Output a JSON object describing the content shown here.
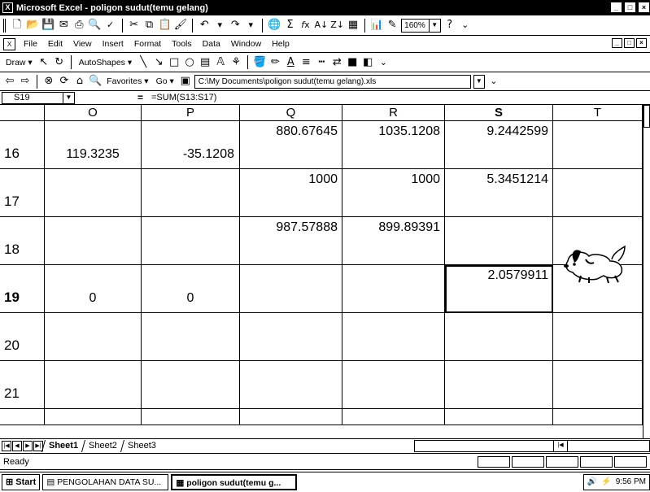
{
  "window": {
    "title": "Microsoft Excel - poligon sudut(temu gelang)",
    "buttons": [
      "_",
      "□",
      "×"
    ]
  },
  "standard_toolbar": {
    "zoom": "160%",
    "help_icon": "help-icon"
  },
  "menu": {
    "items": [
      "File",
      "Edit",
      "View",
      "Insert",
      "Format",
      "Tools",
      "Data",
      "Window",
      "Help"
    ]
  },
  "drawing_toolbar": {
    "draw_label": "Draw",
    "autoshapes_label": "AutoShapes"
  },
  "web_toolbar": {
    "favorites_label": "Favorites",
    "go_label": "Go",
    "address": "C:\\My Documents\\poligon sudut(temu gelang).xls"
  },
  "formula_bar": {
    "name_box": "S19",
    "equals": "=",
    "formula": "=SUM(S13:S17)"
  },
  "columns": [
    "O",
    "P",
    "Q",
    "R",
    "S",
    "T"
  ],
  "selected_column": "S",
  "rows": [
    {
      "num": "16",
      "cells": {
        "O": "119.3235",
        "P": "-35.1208",
        "Q": "880.67645",
        "R": "1035.1208",
        "S": "9.2442599",
        "T": ""
      }
    },
    {
      "num": "17",
      "cells": {
        "O": "",
        "P": "",
        "Q": "1000",
        "R": "1000",
        "S": "5.3451214",
        "T": ""
      }
    },
    {
      "num": "18",
      "cells": {
        "O": "",
        "P": "",
        "Q": "987.57888",
        "R": "899.89391",
        "S": "",
        "T": ""
      }
    },
    {
      "num": "19",
      "cells": {
        "O": "0",
        "P": "0",
        "Q": "",
        "R": "",
        "S": "2.0579911",
        "T": ""
      }
    },
    {
      "num": "20",
      "cells": {
        "O": "",
        "P": "",
        "Q": "",
        "R": "",
        "S": "",
        "T": ""
      }
    },
    {
      "num": "21",
      "cells": {
        "O": "",
        "P": "",
        "Q": "",
        "R": "",
        "S": "",
        "T": ""
      }
    }
  ],
  "selected_row": "19",
  "sheets": [
    "Sheet1",
    "Sheet2",
    "Sheet3"
  ],
  "active_sheet": "Sheet1",
  "status": "Ready",
  "taskbar": {
    "start": "Start",
    "tasks": [
      "PENGOLAHAN DATA SU...",
      "poligon sudut(temu g..."
    ],
    "clock": "9:56 PM"
  },
  "assistant": "office-assistant-dog"
}
